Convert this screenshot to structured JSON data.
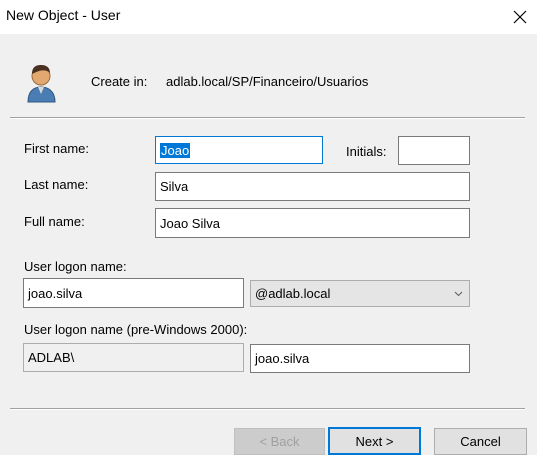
{
  "window": {
    "title": "New Object - User"
  },
  "header": {
    "create_in_label": "Create in:",
    "create_in_path": "adlab.local/SP/Financeiro/Usuarios"
  },
  "form": {
    "first_name_label": "First name:",
    "first_name_value": "Joao",
    "initials_label": "Initials:",
    "initials_value": "",
    "last_name_label": "Last name:",
    "last_name_value": "Silva",
    "full_name_label": "Full name:",
    "full_name_value": "Joao Silva",
    "logon_name_label": "User logon name:",
    "logon_name_value": "joao.silva",
    "upn_suffix_selected": "@adlab.local",
    "pre2000_label": "User logon name (pre-Windows 2000):",
    "pre2000_domain_value": "ADLAB\\",
    "pre2000_name_value": "joao.silva"
  },
  "buttons": {
    "back_label": "< Back",
    "next_label": "Next >",
    "cancel_label": "Cancel"
  },
  "icons": {
    "close": "close-icon",
    "user": "user-icon",
    "dropdown": "chevron-down-icon"
  },
  "colors": {
    "focus_accent": "#0078d7",
    "background": "#f0f0f0"
  }
}
